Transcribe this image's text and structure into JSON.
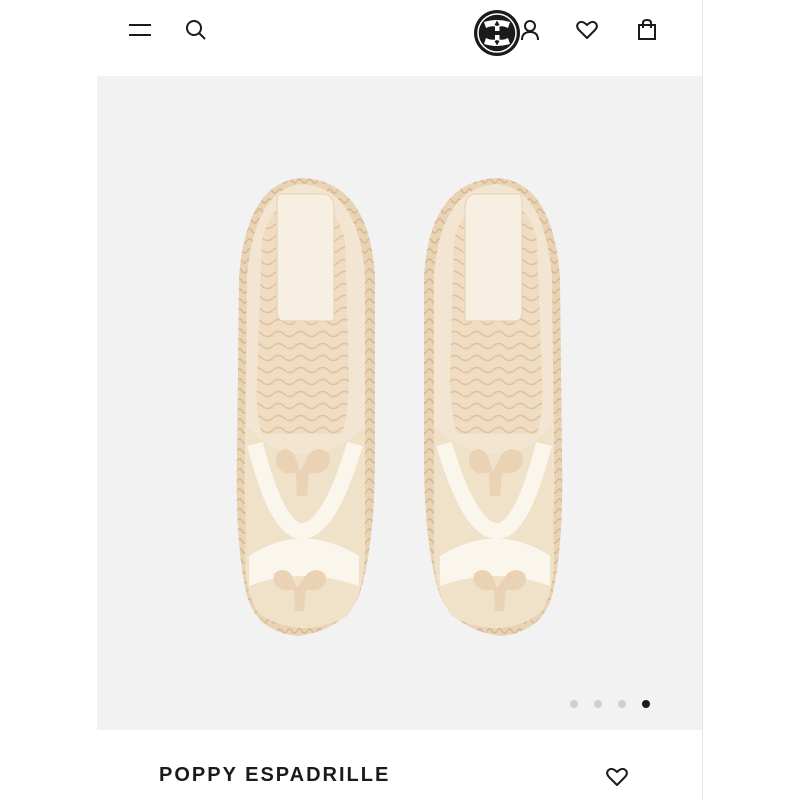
{
  "header": {
    "menu_icon": "hamburger-menu-icon",
    "search_icon": "search-icon",
    "logo": "tory-burch-t-logo",
    "account_icon": "user-icon",
    "wishlist_icon": "heart-icon",
    "bag_icon": "shopping-bag-icon"
  },
  "gallery": {
    "dots": [
      false,
      false,
      false,
      true
    ],
    "active_index": 3
  },
  "product": {
    "name": "POPPY ESPADRILLE",
    "wishlist_icon": "heart-icon"
  },
  "colors": {
    "background": "#ffffff",
    "hero_bg": "#f2f2f2",
    "ink": "#1b1b1b",
    "dot_inactive": "#cfcfcf",
    "shoe_canvas": "#f1e4cf",
    "shoe_patch": "#fbf6ec",
    "jute": "#e4c9a5"
  }
}
